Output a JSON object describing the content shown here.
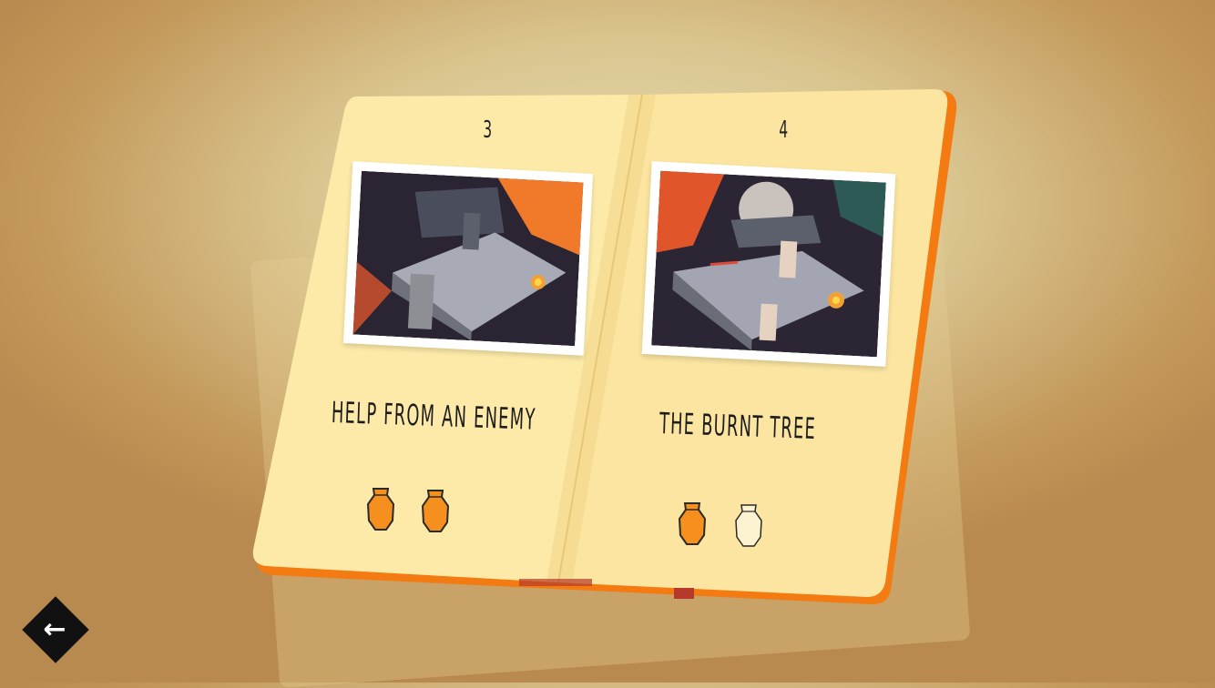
{
  "level_book": {
    "left_page": {
      "number": "3",
      "title": "HELP FROM AN ENEMY",
      "vases_collected": 2,
      "vases_total": 2
    },
    "right_page": {
      "number": "4",
      "title": "THE BURNT TREE",
      "vases_collected": 1,
      "vases_total": 2
    }
  },
  "nav": {
    "back_icon": "arrow-left-icon"
  },
  "colors": {
    "page": "#fdeaa8",
    "cover": "#f47a12",
    "vase_filled": "#f5901e",
    "vase_outline": "#2a2a2a",
    "background": "#d9c48e"
  }
}
